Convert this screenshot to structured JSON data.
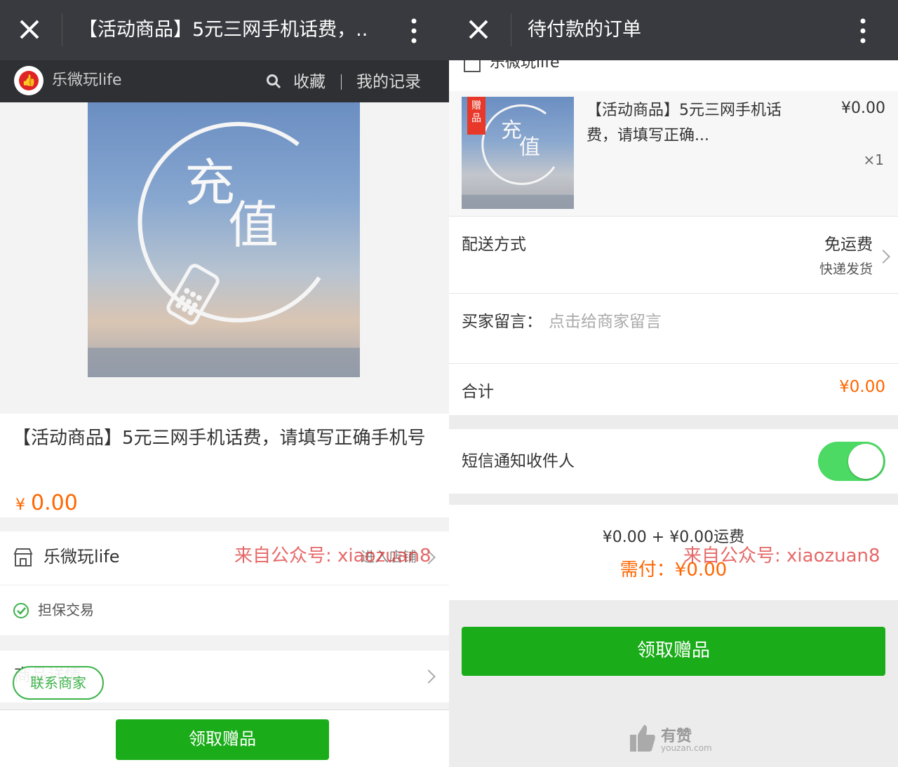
{
  "left": {
    "title": "【活动商品】5元三网手机话费，..",
    "shop_name": "乐微玩life",
    "favorite_label": "收藏",
    "records_label": "我的记录",
    "image_text_1": "充",
    "image_text_2": "值",
    "product_title": "【活动商品】5元三网手机话费，请填写正确手机号",
    "currency": "¥",
    "price": "0.00",
    "store_name": "乐微玩life",
    "enter_store": "进入店铺",
    "guarantee": "担保交易",
    "detail_label": "商品详情",
    "contact_button": "联系商家",
    "claim_button": "领取赠品",
    "watermark": "来自公众号: xiaozuan8"
  },
  "right": {
    "title": "待付款的订单",
    "shop_name": "乐微玩life",
    "gift_ribbon": "赠品",
    "item_name": "【活动商品】5元三网手机话费，请填写正确...",
    "item_price": "¥0.00",
    "item_qty": "×1",
    "delivery_label": "配送方式",
    "delivery_fee": "免运费",
    "delivery_method": "快递发货",
    "message_label": "买家留言：",
    "message_placeholder": "点击给商家留言",
    "total_label": "合计",
    "total_value": "¥0.00",
    "sms_label": "短信通知收件人",
    "sms_enabled": true,
    "summary_line": "¥0.00 + ¥0.00运费",
    "pay_label": "需付：",
    "pay_value": "¥0.00",
    "claim_button": "领取赠品",
    "brand": "有赞",
    "brand_domain": "youzan.com",
    "watermark": "来自公众号: xiaozuan8"
  },
  "colors": {
    "topbar": "#393a3f",
    "accent_green": "#1aad19",
    "price_orange": "#ff6600",
    "toggle_on": "#4cd964"
  }
}
